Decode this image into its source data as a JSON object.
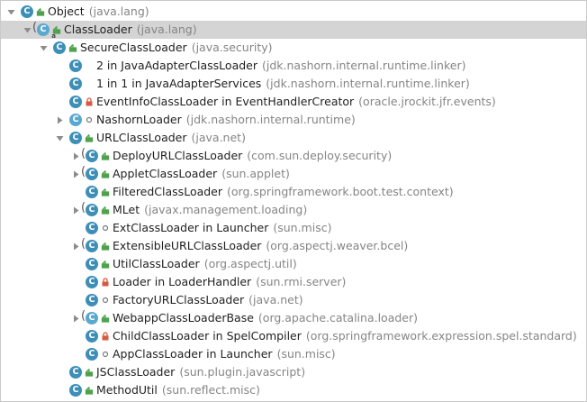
{
  "tree": {
    "rows": [
      {
        "name": "Object",
        "package": "(java.lang)",
        "depth": 0,
        "expander": "expanded",
        "icon": "class-icon",
        "access": "public",
        "overlay": false,
        "selected": false
      },
      {
        "name": "ClassLoader",
        "package": "(java.lang)",
        "depth": 1,
        "expander": "expanded",
        "icon": "abstract-class-icon",
        "access": "public",
        "overlay": true,
        "selected": true
      },
      {
        "name": "SecureClassLoader",
        "package": "(java.security)",
        "depth": 2,
        "expander": "expanded",
        "icon": "class-icon",
        "access": "public",
        "overlay": false,
        "selected": false
      },
      {
        "name": "2 in JavaAdapterClassLoader",
        "package": "(jdk.nashorn.internal.runtime.linker)",
        "depth": 3,
        "expander": "none",
        "icon": "class-icon",
        "access": "none",
        "overlay": false,
        "selected": false
      },
      {
        "name": "1 in 1 in JavaAdapterServices",
        "package": "(jdk.nashorn.internal.runtime.linker)",
        "depth": 3,
        "expander": "none",
        "icon": "class-icon",
        "access": "none",
        "overlay": false,
        "selected": false
      },
      {
        "name": "EventInfoClassLoader in EventHandlerCreator",
        "package": "(oracle.jrockit.jfr.events)",
        "depth": 3,
        "expander": "none",
        "icon": "class-icon",
        "access": "private",
        "overlay": false,
        "selected": false
      },
      {
        "name": "NashornLoader",
        "package": "(jdk.nashorn.internal.runtime)",
        "depth": 3,
        "expander": "collapsed",
        "icon": "abstract-class-icon",
        "access": "package",
        "overlay": false,
        "selected": false
      },
      {
        "name": "URLClassLoader",
        "package": "(java.net)",
        "depth": 3,
        "expander": "expanded",
        "icon": "class-icon",
        "access": "public",
        "overlay": false,
        "selected": false
      },
      {
        "name": "DeployURLClassLoader",
        "package": "(com.sun.deploy.security)",
        "depth": 4,
        "expander": "collapsed",
        "icon": "class-icon",
        "access": "public",
        "overlay": true,
        "selected": false
      },
      {
        "name": "AppletClassLoader",
        "package": "(sun.applet)",
        "depth": 4,
        "expander": "collapsed",
        "icon": "class-icon",
        "access": "public",
        "overlay": true,
        "selected": false
      },
      {
        "name": "FilteredClassLoader",
        "package": "(org.springframework.boot.test.context)",
        "depth": 4,
        "expander": "none",
        "icon": "class-icon",
        "access": "public",
        "overlay": false,
        "selected": false
      },
      {
        "name": "MLet",
        "package": "(javax.management.loading)",
        "depth": 4,
        "expander": "collapsed",
        "icon": "class-icon",
        "access": "public",
        "overlay": true,
        "selected": false
      },
      {
        "name": "ExtClassLoader in Launcher",
        "package": "(sun.misc)",
        "depth": 4,
        "expander": "none",
        "icon": "class-icon",
        "access": "package",
        "overlay": false,
        "selected": false
      },
      {
        "name": "ExtensibleURLClassLoader",
        "package": "(org.aspectj.weaver.bcel)",
        "depth": 4,
        "expander": "collapsed",
        "icon": "class-icon",
        "access": "public",
        "overlay": true,
        "selected": false
      },
      {
        "name": "UtilClassLoader",
        "package": "(org.aspectj.util)",
        "depth": 4,
        "expander": "none",
        "icon": "class-icon",
        "access": "public",
        "overlay": false,
        "selected": false
      },
      {
        "name": "Loader in LoaderHandler",
        "package": "(sun.rmi.server)",
        "depth": 4,
        "expander": "none",
        "icon": "class-icon",
        "access": "private",
        "overlay": false,
        "selected": false
      },
      {
        "name": "FactoryURLClassLoader",
        "package": "(java.net)",
        "depth": 4,
        "expander": "none",
        "icon": "class-icon",
        "access": "package",
        "overlay": false,
        "selected": false
      },
      {
        "name": "WebappClassLoaderBase",
        "package": "(org.apache.catalina.loader)",
        "depth": 4,
        "expander": "collapsed",
        "icon": "abstract-class-icon",
        "access": "public",
        "overlay": true,
        "selected": false
      },
      {
        "name": "ChildClassLoader in SpelCompiler",
        "package": "(org.springframework.expression.spel.standard)",
        "depth": 4,
        "expander": "none",
        "icon": "class-icon",
        "access": "private",
        "overlay": false,
        "selected": false
      },
      {
        "name": "AppClassLoader in Launcher",
        "package": "(sun.misc)",
        "depth": 4,
        "expander": "none",
        "icon": "class-icon",
        "access": "package",
        "overlay": false,
        "selected": false
      },
      {
        "name": "JSClassLoader",
        "package": "(sun.plugin.javascript)",
        "depth": 3,
        "expander": "none",
        "icon": "class-icon",
        "access": "public",
        "overlay": false,
        "selected": false
      },
      {
        "name": "MethodUtil",
        "package": "(sun.reflect.misc)",
        "depth": 3,
        "expander": "none",
        "icon": "class-icon",
        "access": "public",
        "overlay": false,
        "selected": false
      }
    ]
  },
  "colors": {
    "class_icon": "#3d8fb8",
    "abstract_icon": "#5aa8cf",
    "public_access": "#4ea24e",
    "private_access": "#d8593f",
    "package_access": "#7a7a7a",
    "selection": "#d4d4d4",
    "package_text": "#858585"
  }
}
